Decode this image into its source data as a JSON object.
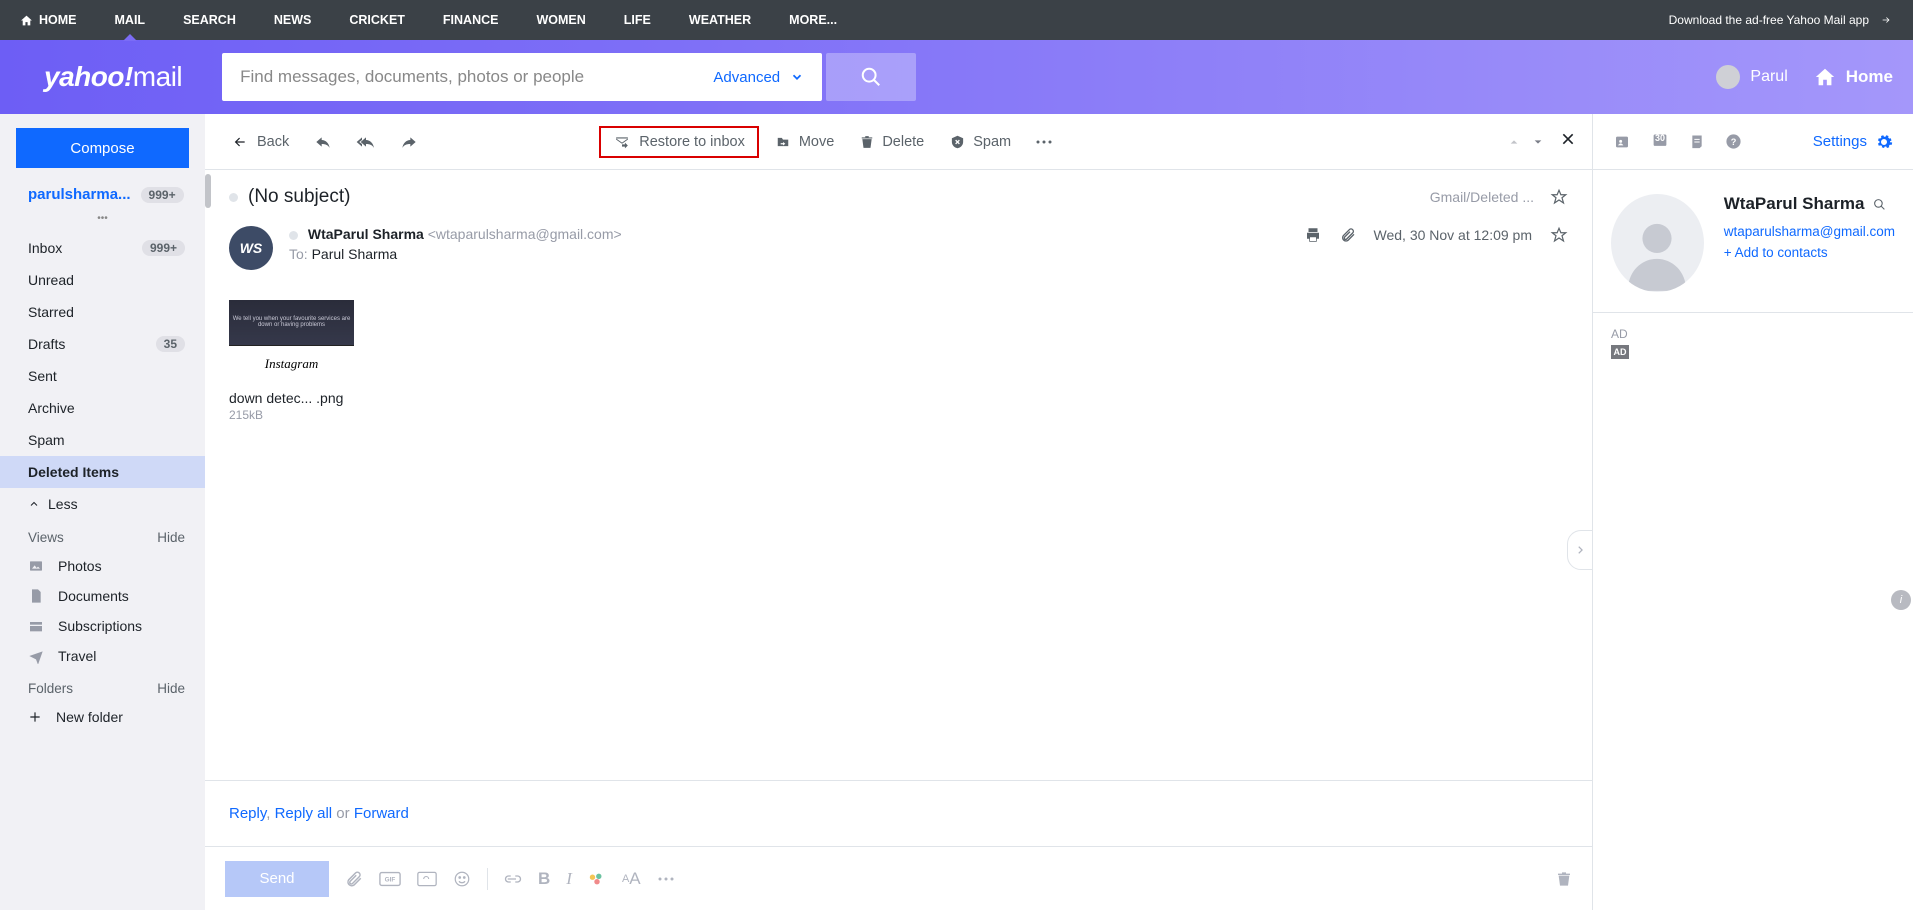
{
  "topnav": {
    "items": [
      "HOME",
      "MAIL",
      "SEARCH",
      "NEWS",
      "CRICKET",
      "FINANCE",
      "WOMEN",
      "LIFE",
      "WEATHER",
      "MORE..."
    ],
    "download": "Download the ad-free Yahoo Mail app"
  },
  "header": {
    "logo_pre": "yahoo",
    "logo_mail": "mail",
    "search_placeholder": "Find messages, documents, photos or people",
    "advanced": "Advanced",
    "profile_name": "Parul",
    "home": "Home"
  },
  "sidebar": {
    "compose": "Compose",
    "account": "parulsharma...",
    "account_badge": "999+",
    "folders": [
      {
        "label": "Inbox",
        "badge": "999+"
      },
      {
        "label": "Unread"
      },
      {
        "label": "Starred"
      },
      {
        "label": "Drafts",
        "badge": "35"
      },
      {
        "label": "Sent"
      },
      {
        "label": "Archive"
      },
      {
        "label": "Spam"
      },
      {
        "label": "Deleted Items",
        "selected": true
      }
    ],
    "less": "Less",
    "views_label": "Views",
    "hide": "Hide",
    "views": [
      "Photos",
      "Documents",
      "Subscriptions",
      "Travel"
    ],
    "folders_label": "Folders",
    "new_folder": "New folder"
  },
  "toolbar": {
    "back": "Back",
    "restore": "Restore to inbox",
    "move": "Move",
    "delete": "Delete",
    "spam": "Spam"
  },
  "message": {
    "subject": "(No subject)",
    "folder_path": "Gmail/Deleted ...",
    "from_name": "WtaParul Sharma",
    "from_addr": "<wtaparulsharma@gmail.com>",
    "to_label": "To:",
    "to_name": "Parul Sharma",
    "date": "Wed, 30 Nov at 12:09 pm",
    "avatar_initials": "WS",
    "attachment": {
      "caption": "We tell you when your favourite services are down or having problems",
      "brand": "Instagram",
      "name": "down detec... .png",
      "size": "215kB"
    }
  },
  "reply": {
    "reply": "Reply",
    "reply_all": "Reply all",
    "or": "or",
    "forward": "Forward",
    "send": "Send"
  },
  "rightpanel": {
    "settings": "Settings",
    "name": "WtaParul Sharma",
    "email": "wtaparulsharma@gmail.com",
    "add": "+ Add to contacts",
    "ad": "AD",
    "cal_day": "30"
  }
}
